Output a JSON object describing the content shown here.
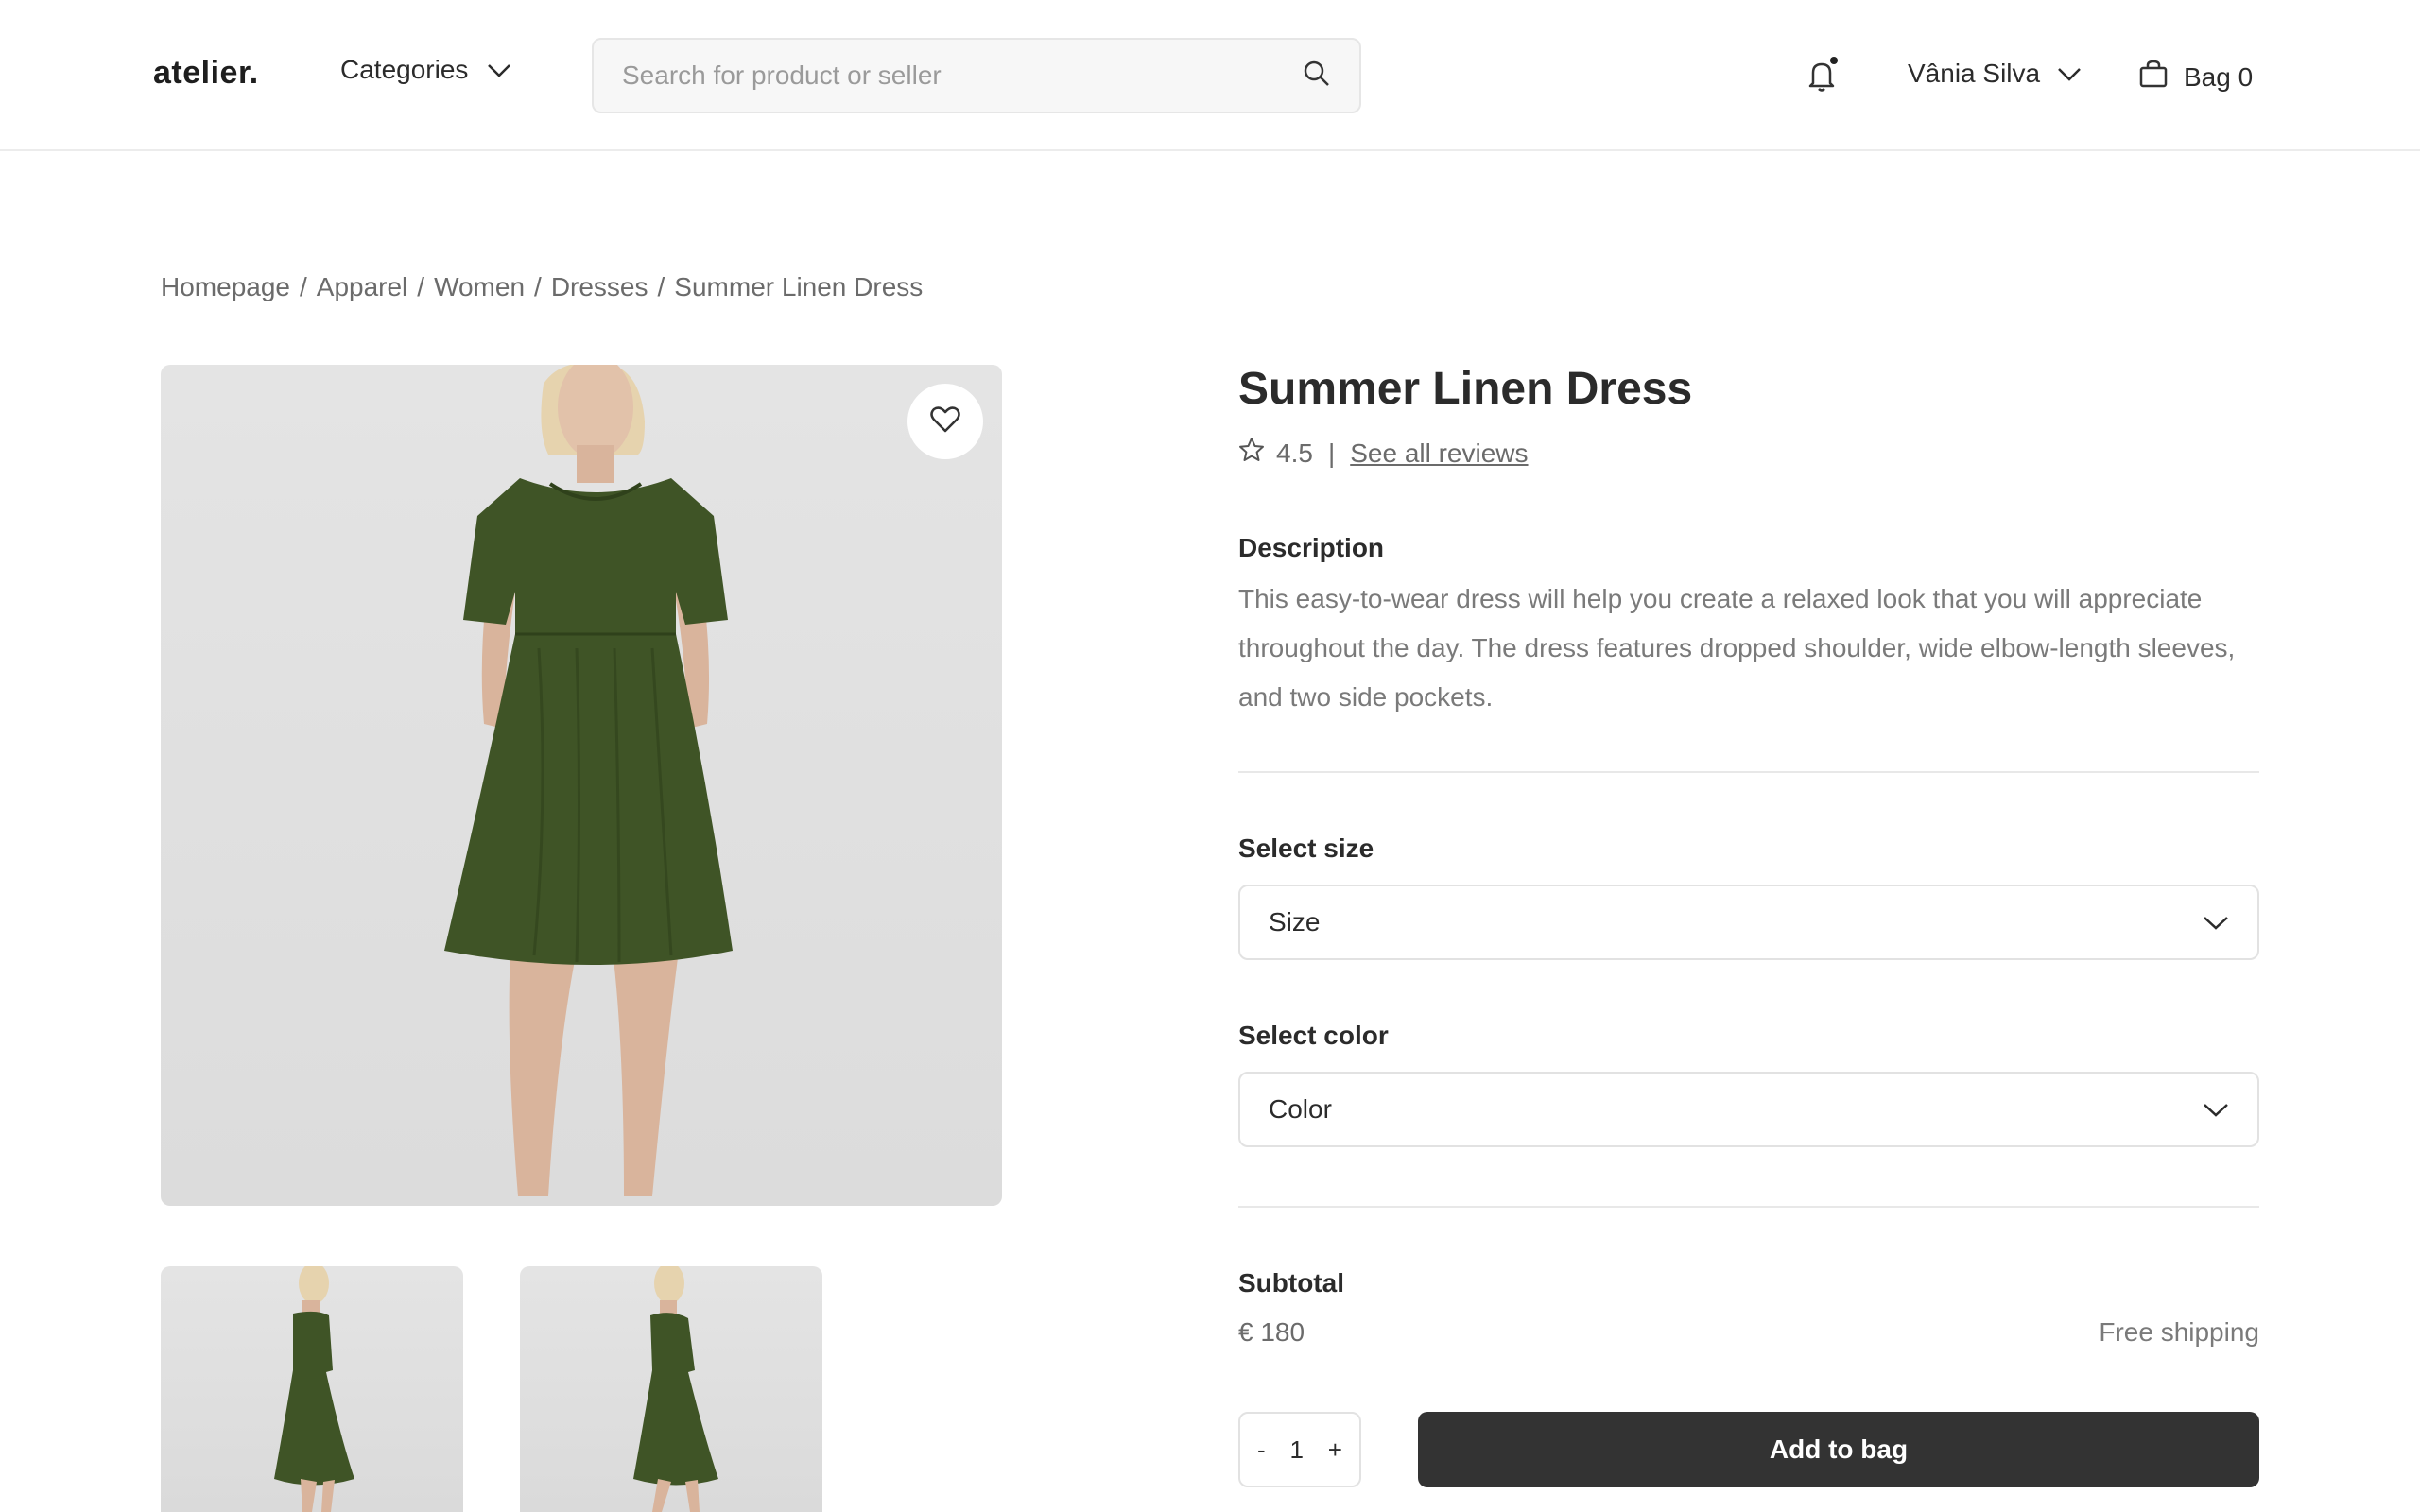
{
  "header": {
    "logo": "atelier.",
    "categories_label": "Categories",
    "search_placeholder": "Search for product or seller",
    "user_name": "Vânia Silva",
    "bag_label": "Bag 0"
  },
  "breadcrumb": [
    "Homepage",
    "Apparel",
    "Women",
    "Dresses",
    "Summer Linen Dress"
  ],
  "product": {
    "title": "Summer Linen Dress",
    "rating": "4.5",
    "reviews_link": "See all reviews",
    "description_label": "Description",
    "description": "This easy-to-wear dress will help you create a relaxed look that you will appreciate throughout the day. The dress features dropped shoulder, wide elbow-length sleeves, and two side pockets.",
    "size_label": "Select size",
    "size_value": "Size",
    "color_label": "Select color",
    "color_value": "Color",
    "subtotal_label": "Subtotal",
    "price": "€ 180",
    "shipping": "Free shipping",
    "quantity": "1",
    "qty_minus": "-",
    "qty_plus": "+",
    "add_button": "Add to bag"
  },
  "colors": {
    "dress": "#3f5426",
    "dress_shadow": "#2f411b",
    "skin": "#d9b49c",
    "hair": "#e6d3ae",
    "button_dark": "#333333"
  },
  "icons": [
    "chevron-down-icon",
    "search-icon",
    "bell-icon",
    "bag-icon",
    "heart-icon",
    "star-icon"
  ]
}
